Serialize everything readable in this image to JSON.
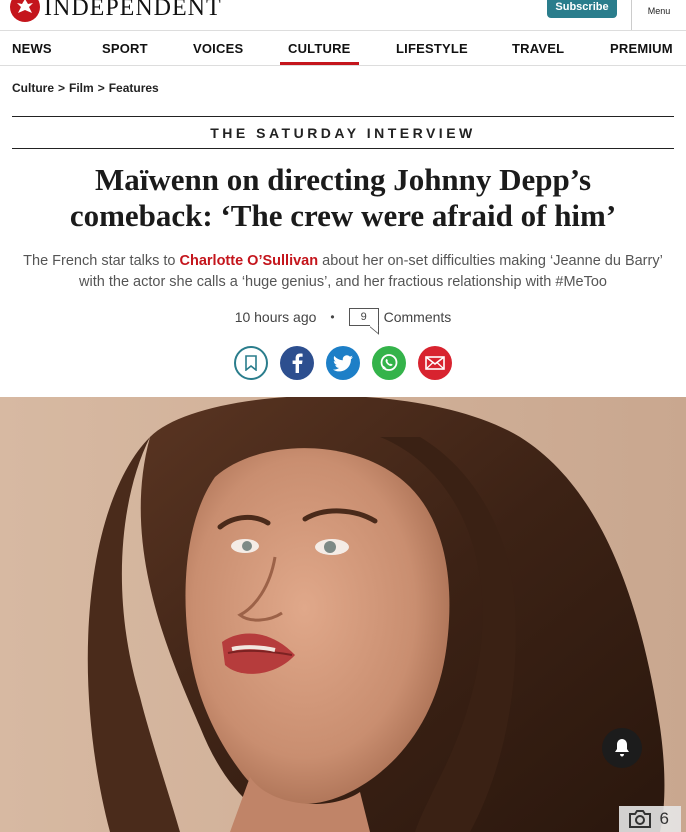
{
  "header": {
    "logo_text": "INDEPENDENT",
    "subscribe_label": "Subscribe",
    "menu_label": "Menu"
  },
  "nav": {
    "items": [
      "NEWS",
      "SPORT",
      "VOICES",
      "CULTURE",
      "LIFESTYLE",
      "TRAVEL",
      "PREMIUM"
    ],
    "active": "CULTURE"
  },
  "breadcrumb": {
    "items": [
      "Culture",
      "Film",
      "Features"
    ],
    "separator": ">"
  },
  "article": {
    "kicker": "THE SATURDAY INTERVIEW",
    "headline_line1": "Maïwenn on directing Johnny Depp’s",
    "headline_line2": "comeback: ‘The crew were afraid of him’",
    "standfirst_pre": "The French star talks to ",
    "author": "Charlotte O’Sullivan",
    "standfirst_post": " about her on-set difficulties making ‘Jeanne du Barry’ with the actor she calls a ‘huge genius’, and her fractious relationship with #MeToo",
    "time_ago": "10 hours ago",
    "comment_count": "9",
    "comments_label": "Comments"
  },
  "share": {
    "icons": [
      "bookmark-icon",
      "facebook-icon",
      "twitter-icon",
      "whatsapp-icon",
      "email-icon"
    ]
  },
  "hero": {
    "photo_count": "6"
  },
  "colors": {
    "brand_red": "#c4151c",
    "subscribe_teal": "#2a7d8c"
  }
}
